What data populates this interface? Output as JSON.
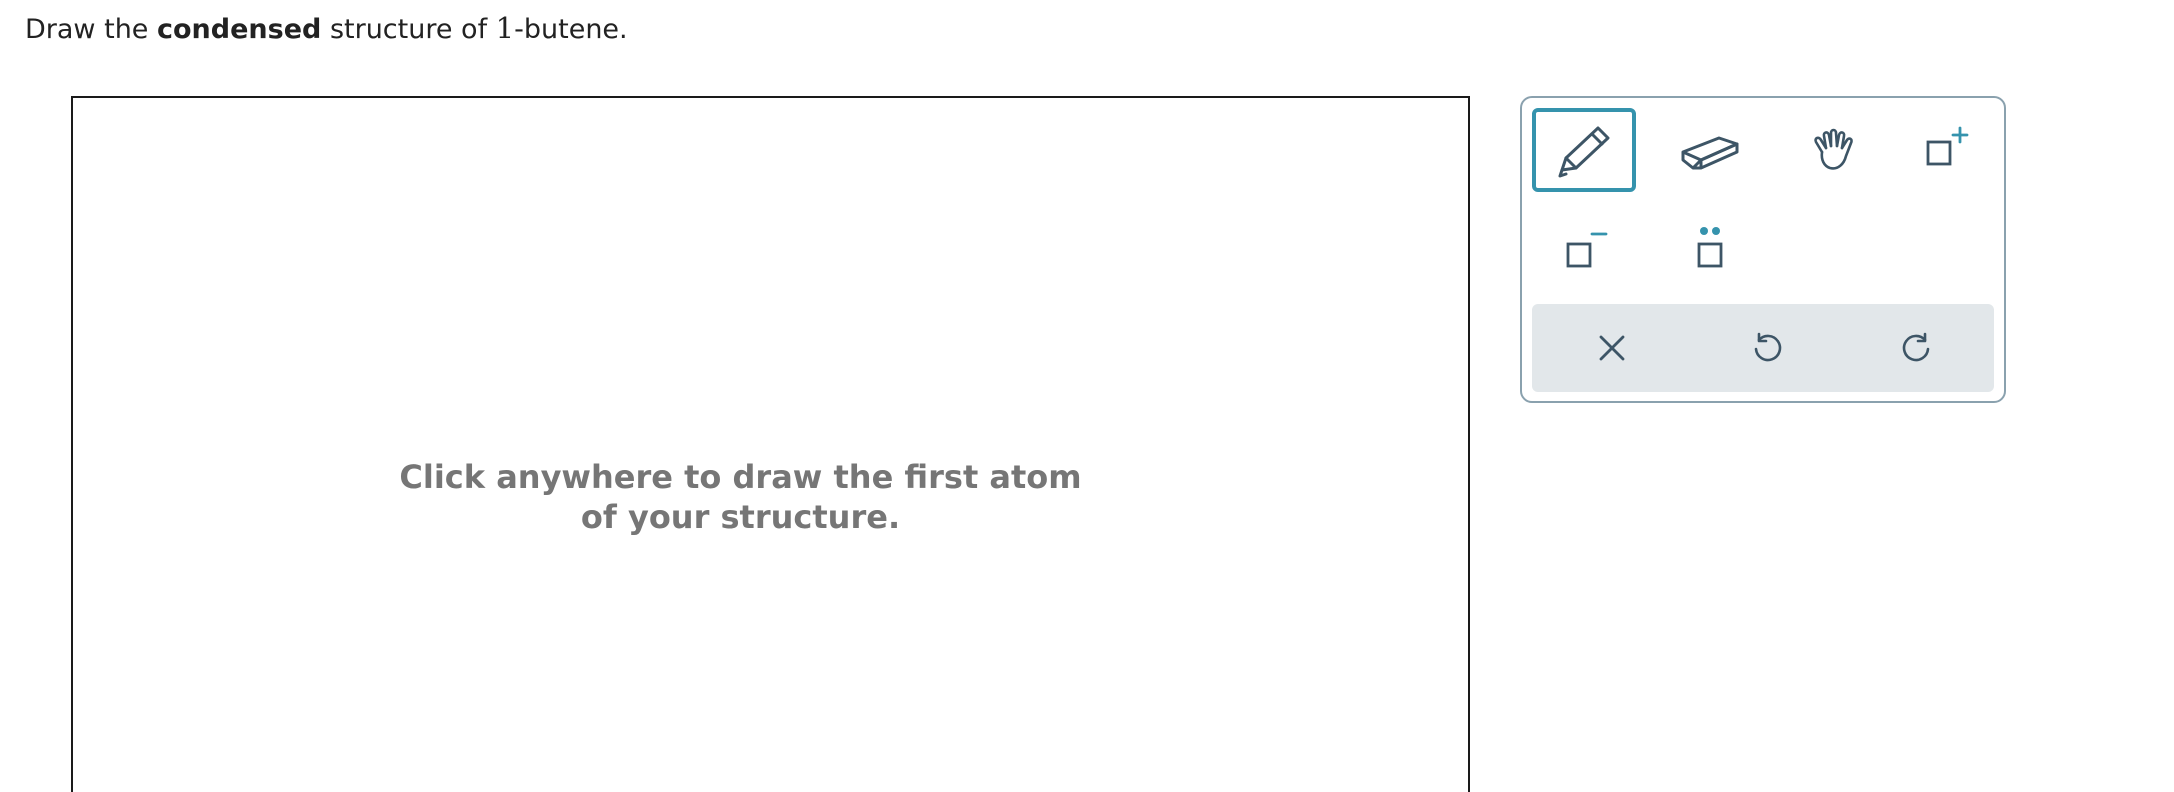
{
  "question": {
    "prefix": "Draw the ",
    "emphasis": "condensed",
    "middle": " structure of ",
    "number": "1",
    "suffix": "-butene."
  },
  "canvas": {
    "hint_line1": "Click anywhere to draw the first atom",
    "hint_line2": "of your structure."
  },
  "toolbox": {
    "tools": [
      {
        "name": "pencil",
        "icon": "pencil-icon",
        "selected": true
      },
      {
        "name": "eraser",
        "icon": "eraser-icon",
        "selected": false
      },
      {
        "name": "hand",
        "icon": "hand-icon",
        "selected": false
      },
      {
        "name": "add-positive-charge",
        "icon": "positive-charge-icon",
        "selected": false
      },
      {
        "name": "add-negative-charge",
        "icon": "negative-charge-icon",
        "selected": false
      },
      {
        "name": "add-lone-pair",
        "icon": "lone-pair-icon",
        "selected": false
      }
    ],
    "actions": [
      {
        "name": "clear",
        "icon": "close-icon"
      },
      {
        "name": "undo",
        "icon": "undo-icon"
      },
      {
        "name": "redo",
        "icon": "redo-icon"
      }
    ]
  },
  "colors": {
    "icon": "#3d5566",
    "accent": "#3593ad",
    "hint_text": "#767676",
    "action_bar": "#e2e7ea",
    "toolbox_border": "#8aa1ae"
  }
}
